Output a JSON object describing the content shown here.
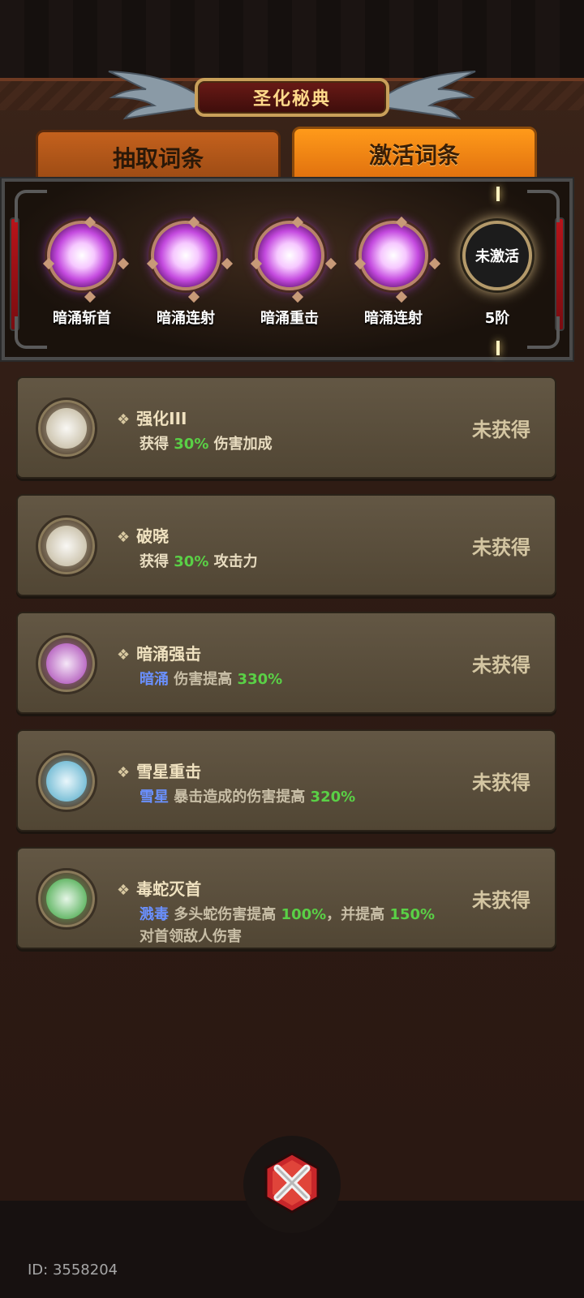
{
  "header": {
    "title": "圣化秘典"
  },
  "tabs": [
    {
      "label": "抽取词条",
      "active": false
    },
    {
      "label": "激活词条",
      "active": true
    }
  ],
  "active_slots": [
    {
      "label": "暗涌斩首",
      "state": "active",
      "orb_icon": "purple-orb-icon"
    },
    {
      "label": "暗涌连射",
      "state": "active",
      "orb_icon": "purple-orb-icon"
    },
    {
      "label": "暗涌重击",
      "state": "active",
      "orb_icon": "purple-orb-icon"
    },
    {
      "label": "暗涌连射",
      "state": "active",
      "orb_icon": "purple-orb-icon"
    },
    {
      "label": "5阶",
      "state": "locked",
      "center_text": "未激活"
    }
  ],
  "entries": [
    {
      "name": "强化III",
      "gem_color": "#d8d0b8",
      "desc": [
        {
          "t": "获得 ",
          "c": "text"
        },
        {
          "t": "30%",
          "c": "num"
        },
        {
          "t": " 伤害加成",
          "c": "text"
        }
      ],
      "status": "未获得"
    },
    {
      "name": "破晓",
      "gem_color": "#d8d0b8",
      "desc": [
        {
          "t": "获得 ",
          "c": "text"
        },
        {
          "t": "30%",
          "c": "num"
        },
        {
          "t": " 攻击力",
          "c": "text"
        }
      ],
      "status": "未获得"
    },
    {
      "name": "暗涌强击",
      "gem_color": "#c060d0",
      "desc": [
        {
          "t": "暗涌",
          "c": "tag"
        },
        {
          "t": " 伤害提高 ",
          "c": "muted"
        },
        {
          "t": "330%",
          "c": "num"
        }
      ],
      "status": "未获得"
    },
    {
      "name": "雪星重击",
      "gem_color": "#70c8e8",
      "desc": [
        {
          "t": "雪星",
          "c": "tag"
        },
        {
          "t": " 暴击造成的伤害提高 ",
          "c": "muted"
        },
        {
          "t": "320%",
          "c": "num"
        }
      ],
      "status": "未获得"
    },
    {
      "name": "毒蛇灭首",
      "gem_color": "#58c060",
      "desc": [
        {
          "t": "溅毒",
          "c": "tag"
        },
        {
          "t": " 多头蛇伤害提高 ",
          "c": "muted"
        },
        {
          "t": "100%",
          "c": "num"
        },
        {
          "t": "，并提高 ",
          "c": "muted"
        },
        {
          "t": "150%",
          "c": "num"
        },
        {
          "t": " 对首领敌人伤害",
          "c": "muted"
        }
      ],
      "status": "未获得"
    }
  ],
  "footer": {
    "id_text": "ID: 3558204"
  },
  "colors": {
    "accent_green": "#5ad046",
    "tag_blue": "#6a90ff",
    "tab_active": "#ff9a1a"
  }
}
